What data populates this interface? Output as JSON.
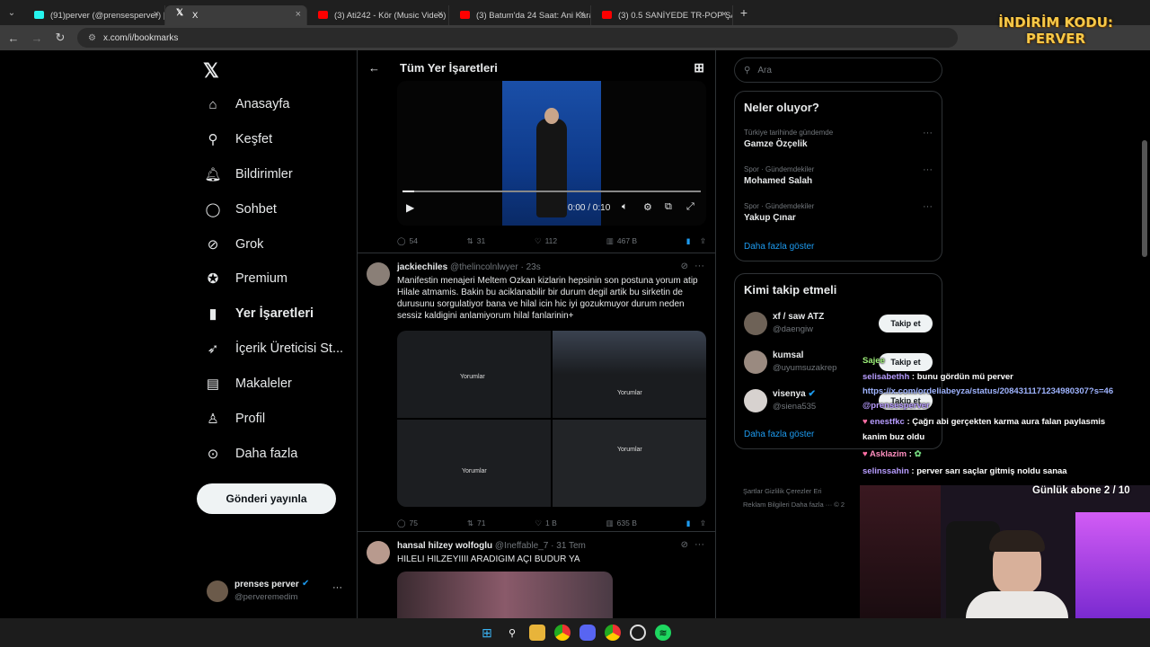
{
  "browser": {
    "tabs": [
      {
        "title": "(91)perver (@prensesperver) | T",
        "favicon_color": "#25f4ee"
      },
      {
        "title": "X",
        "favicon_color": "#ffffff"
      },
      {
        "title": "(3) Ati242 - Kör (Music Video) -",
        "favicon_color": "#ff0000"
      },
      {
        "title": "(3) Batum'da 24 Saat: Ani Karar",
        "favicon_color": "#ff0000"
      },
      {
        "title": "(3) 0.5 SANİYEDE TR-POP ŞARK",
        "favicon_color": "#ff0000"
      }
    ],
    "url": "x.com/i/bookmarks"
  },
  "nav": {
    "items": [
      {
        "label": "Anasayfa",
        "icon": "home-icon"
      },
      {
        "label": "Keşfet",
        "icon": "search-icon"
      },
      {
        "label": "Bildirimler",
        "icon": "bell-icon"
      },
      {
        "label": "Sohbet",
        "icon": "chat-icon"
      },
      {
        "label": "Grok",
        "icon": "grok-icon"
      },
      {
        "label": "Premium",
        "icon": "premium-icon"
      },
      {
        "label": "Yer İşaretleri",
        "icon": "bookmark-icon"
      },
      {
        "label": "İçerik Üreticisi St...",
        "icon": "rocket-icon"
      },
      {
        "label": "Makaleler",
        "icon": "article-icon"
      },
      {
        "label": "Profil",
        "icon": "person-icon"
      },
      {
        "label": "Daha fazla",
        "icon": "more-icon"
      }
    ],
    "post_button": "Gönderi yayınla",
    "account": {
      "name": "prenses perver",
      "handle": "@perveremedim"
    }
  },
  "feed": {
    "title": "Tüm Yer İşaretleri",
    "video": {
      "time": "0:00 / 0:10"
    },
    "tweet0_metrics": {
      "replies": "54",
      "retweets": "31",
      "likes": "112",
      "views": "467 B"
    },
    "tweets": [
      {
        "name": "jackiechiles",
        "handle": "@thelincolnlwyer",
        "time": "· 23s",
        "text": "Manifestin menajeri Meltem Ozkan kizlarin hepsinin son postuna yorum atip Hilale atmamis. Bakin bu aciklanabilir bir durum degil artik bu sirketin de durusunu sorgulatiyor bana ve hilal icin hic iyi gozukmuyor durum neden sessiz kaldigini anlamiyorum hilal fanlarinin+",
        "image_label": "Yorumlar",
        "replies": "75",
        "retweets": "71",
        "likes": "1 B",
        "views": "635 B"
      },
      {
        "name": "hansal hilzey wolfoglu",
        "handle": "@Ineffable_7",
        "time": "· 31 Tem",
        "text": "HILELI HILZEYIIII ARADIGIM AÇI BUDUR YA"
      }
    ]
  },
  "sidebar": {
    "search_placeholder": "Ara",
    "trends_title": "Neler oluyor?",
    "trends": [
      {
        "category": "Türkiye tarihinde gündemde",
        "name": "Gamze Özçelik"
      },
      {
        "category": "Spor · Gündemdekiler",
        "name": "Mohamed Salah"
      },
      {
        "category": "Spor · Gündemdekiler",
        "name": "Yakup Çınar"
      }
    ],
    "show_more": "Daha fazla göster",
    "follow_title": "Kimi takip etmeli",
    "follow": [
      {
        "name": "xf / saw ATZ",
        "handle": "@daengiw",
        "button": "Takip et"
      },
      {
        "name": "kumsal",
        "handle": "@uyumsuzakrep",
        "button": "Takip et"
      },
      {
        "name": "visenya",
        "handle": "@siena535",
        "button": "Takip et"
      }
    ],
    "follow_more": "Daha fazla göster",
    "footer_line1": "Şartlar    Gizlilik    Çerezler    Eri",
    "footer_line2": "Reklam Bilgileri    Daha fazla ···    © 2"
  },
  "overlay": {
    "promo_line1": "İNDİRİM KODU:",
    "promo_line2": "PERVER",
    "chat": [
      {
        "user": "Sajee",
        "msg": ""
      },
      {
        "user": "selisabethh",
        "msg": ": bunu gördün mü perver"
      },
      {
        "user": "",
        "msg": "https://x.com/ordeliabeyza/status/2084311171234980307?s=46"
      },
      {
        "user": "@prensesperver",
        "msg": ""
      },
      {
        "user": "enestfkc",
        "msg": ": Çağrı abi gerçekten karma aura falan paylasmis"
      },
      {
        "user": "",
        "msg": "kanim buz oldu"
      },
      {
        "user": "Asklazim",
        "msg": ":"
      },
      {
        "user": "selinssahin",
        "msg": ": perver sarı saçlar gitmiş noldu sanaa"
      }
    ],
    "sub_goal": "Günlük abone 2 / 10"
  },
  "colors": {
    "accent": "#1d9bf0",
    "background": "#000000",
    "border": "#2f3336",
    "muted": "#71767b"
  }
}
